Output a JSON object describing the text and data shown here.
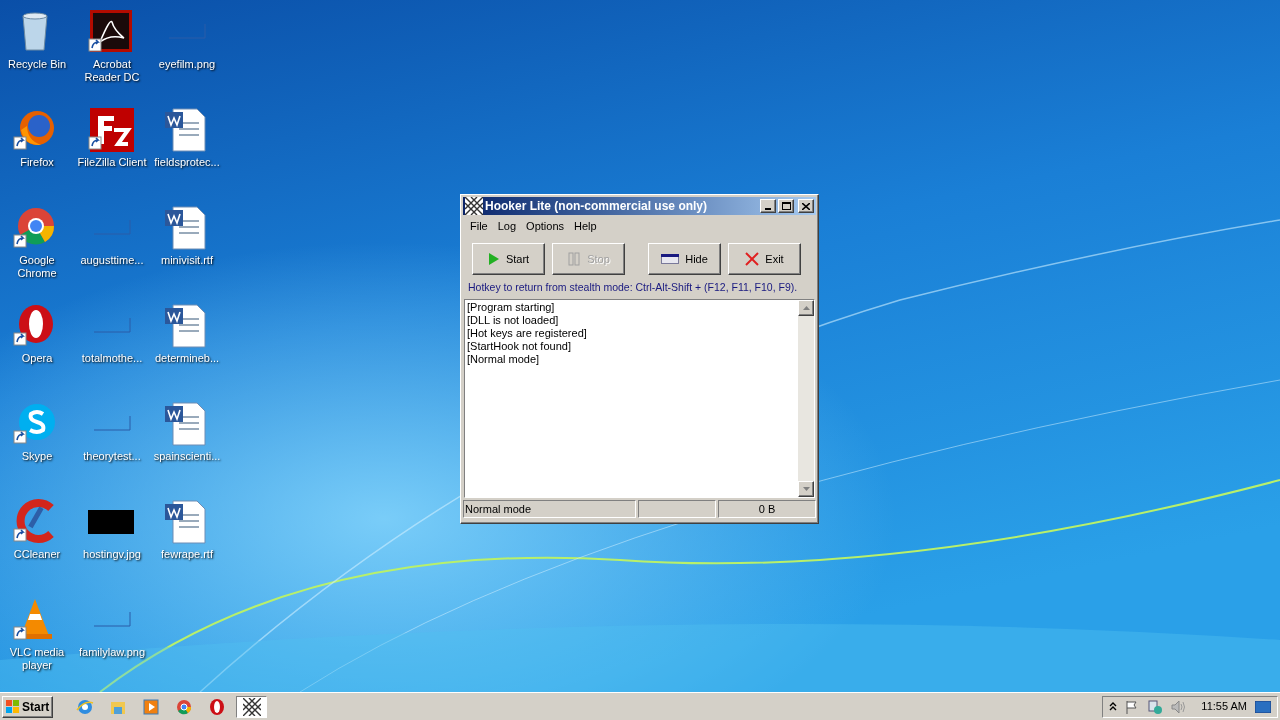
{
  "desktop_icons": [
    {
      "label": "Recycle Bin",
      "kind": "recycle",
      "shortcut": false
    },
    {
      "label": "Firefox",
      "kind": "firefox",
      "shortcut": true
    },
    {
      "label": "Google Chrome",
      "kind": "chrome",
      "shortcut": true
    },
    {
      "label": "Opera",
      "kind": "opera",
      "shortcut": true
    },
    {
      "label": "Skype",
      "kind": "skype",
      "shortcut": true
    },
    {
      "label": "CCleaner",
      "kind": "ccleaner",
      "shortcut": true
    },
    {
      "label": "VLC media player",
      "kind": "vlc",
      "shortcut": true
    },
    {
      "label": "Acrobat Reader DC",
      "kind": "acrobat",
      "shortcut": true
    },
    {
      "label": "FileZilla Client",
      "kind": "filezilla",
      "shortcut": true
    },
    {
      "label": "augusttime...",
      "kind": "blank",
      "shortcut": false
    },
    {
      "label": "totalmothe...",
      "kind": "blank",
      "shortcut": false
    },
    {
      "label": "theorytest...",
      "kind": "blank",
      "shortcut": false
    },
    {
      "label": "hostingv.jpg",
      "kind": "black",
      "shortcut": false
    },
    {
      "label": "familylaw.png",
      "kind": "blank",
      "shortcut": false
    },
    {
      "label": "eyefilm.png",
      "kind": "blank",
      "shortcut": false
    },
    {
      "label": "fieldsprotec...",
      "kind": "word",
      "shortcut": false
    },
    {
      "label": "minivisit.rtf",
      "kind": "word",
      "shortcut": false
    },
    {
      "label": "determineb...",
      "kind": "word",
      "shortcut": false
    },
    {
      "label": "spainscienti...",
      "kind": "word",
      "shortcut": false
    },
    {
      "label": "fewrape.rtf",
      "kind": "word",
      "shortcut": false
    }
  ],
  "window": {
    "title": "Hooker Lite (non-commercial use only)",
    "menu": [
      "File",
      "Log",
      "Options",
      "Help"
    ],
    "buttons": [
      {
        "label": "Start",
        "kind": "start",
        "disabled": false
      },
      {
        "label": "Stop",
        "kind": "stop",
        "disabled": true
      },
      {
        "label": "Hide",
        "kind": "hide",
        "disabled": false
      },
      {
        "label": "Exit",
        "kind": "exit",
        "disabled": false
      }
    ],
    "hotkey_text": "Hotkey to return from stealth mode: Ctrl-Alt-Shift + (F12, F11, F10, F9).",
    "log_lines": [
      "[Program starting]",
      "[DLL is not loaded]",
      "[Hot keys are registered]",
      "[StartHook not found]",
      "[Normal mode]"
    ],
    "status_bar": {
      "mode": "Normal mode",
      "size": "0 B"
    }
  },
  "taskbar": {
    "start_label": "Start",
    "items": [
      {
        "kind": "ie",
        "selected": false
      },
      {
        "kind": "explorer",
        "selected": false
      },
      {
        "kind": "media",
        "selected": false
      },
      {
        "kind": "chrome",
        "selected": false
      },
      {
        "kind": "opera",
        "selected": false
      },
      {
        "kind": "hooker",
        "selected": true
      }
    ],
    "clock": "11:55 AM"
  }
}
